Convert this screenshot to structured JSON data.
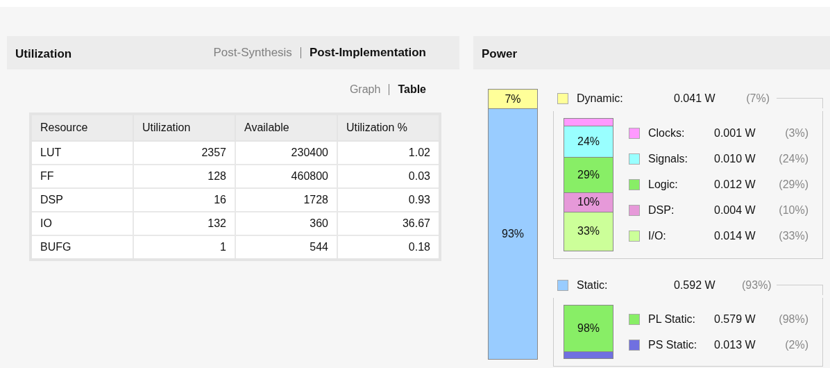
{
  "utilization": {
    "title": "Utilization",
    "tabs": [
      {
        "label": "Post-Synthesis",
        "selected": false
      },
      {
        "label": "Post-Implementation",
        "selected": true
      }
    ],
    "views": [
      {
        "label": "Graph",
        "selected": false
      },
      {
        "label": "Table",
        "selected": true
      }
    ],
    "table": {
      "columns": [
        "Resource",
        "Utilization",
        "Available",
        "Utilization %"
      ],
      "rows": [
        [
          "LUT",
          "2357",
          "230400",
          "1.02"
        ],
        [
          "FF",
          "128",
          "460800",
          "0.03"
        ],
        [
          "DSP",
          "16",
          "1728",
          "0.93"
        ],
        [
          "IO",
          "132",
          "360",
          "36.67"
        ],
        [
          "BUFG",
          "1",
          "544",
          "0.18"
        ]
      ]
    }
  },
  "power": {
    "title": "Power",
    "total_bar": [
      {
        "label": "7%",
        "level": 0.07,
        "color": "#ffff99"
      },
      {
        "label": "93%",
        "level": 0.93,
        "color": "#99ccff"
      }
    ],
    "groups": [
      {
        "name": "Dynamic:",
        "value": "0.041 W",
        "percent": "(7%)",
        "color": "#ffff99",
        "items": [
          {
            "name": "Clocks:",
            "value": "0.001 W",
            "percent": "(3%)",
            "color": "#ff99ff"
          },
          {
            "name": "Signals:",
            "value": "0.010 W",
            "percent": "(24%)",
            "color": "#99ffff",
            "label": "24%"
          },
          {
            "name": "Logic:",
            "value": "0.012 W",
            "percent": "(29%)",
            "color": "#88ee66",
            "label": "29%"
          },
          {
            "name": "DSP:",
            "value": "0.004 W",
            "percent": "(10%)",
            "color": "#e699d9",
            "label": "10%"
          },
          {
            "name": "I/O:",
            "value": "0.014 W",
            "percent": "(33%)",
            "color": "#ccff99",
            "label": "33%"
          }
        ]
      },
      {
        "name": "Static:",
        "value": "0.592 W",
        "percent": "(93%)",
        "color": "#99ccff",
        "items": [
          {
            "name": "PL Static:",
            "value": "0.579 W",
            "percent": "(98%)",
            "color": "#88ee66",
            "label": "98%"
          },
          {
            "name": "PS Static:",
            "value": "0.013 W",
            "percent": "(2%)",
            "color": "#7070e0"
          }
        ]
      }
    ]
  }
}
